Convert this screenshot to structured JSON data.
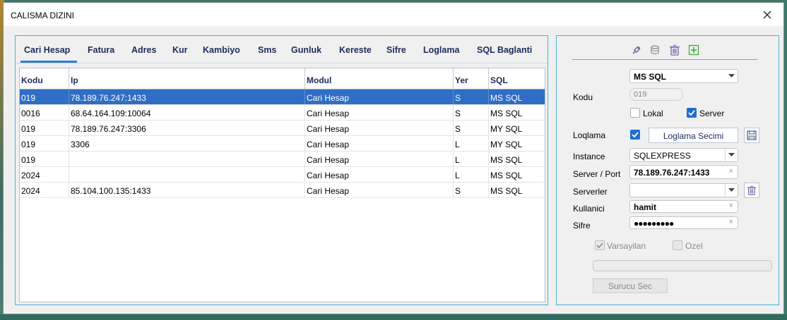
{
  "window": {
    "title": "CALISMA DIZINI"
  },
  "tabs": [
    {
      "label": "Cari Hesap",
      "active": true
    },
    {
      "label": "Fatura"
    },
    {
      "label": "Adres"
    },
    {
      "label": "Kur"
    },
    {
      "label": "Kambiyo"
    },
    {
      "label": "Sms"
    },
    {
      "label": "Gunluk"
    },
    {
      "label": "Kereste"
    },
    {
      "label": "Sifre"
    },
    {
      "label": "Loglama"
    },
    {
      "label": "SQL Baglanti"
    }
  ],
  "grid": {
    "columns": [
      "Kodu",
      "Ip",
      "Modul",
      "Yer",
      "SQL"
    ],
    "rows": [
      {
        "kodu": "019",
        "ip": "78.189.76.247:1433",
        "modul": "Cari Hesap",
        "yer": "S",
        "sql": "MS SQL",
        "selected": true
      },
      {
        "kodu": "0016",
        "ip": "68.64.164.109:10064",
        "modul": "Cari Hesap",
        "yer": "S",
        "sql": "MS SQL"
      },
      {
        "kodu": "019",
        "ip": "78.189.76.247:3306",
        "modul": "Cari Hesap",
        "yer": "S",
        "sql": "MY SQL"
      },
      {
        "kodu": "019",
        "ip": "3306",
        "modul": "Cari Hesap",
        "yer": "L",
        "sql": "MY SQL"
      },
      {
        "kodu": "019",
        "ip": "",
        "modul": "Cari Hesap",
        "yer": "L",
        "sql": "MS SQL"
      },
      {
        "kodu": "2024",
        "ip": "",
        "modul": "Cari Hesap",
        "yer": "L",
        "sql": "MS SQL"
      },
      {
        "kodu": "2024",
        "ip": "85.104.100.135:1433",
        "modul": "Cari Hesap",
        "yer": "S",
        "sql": "MS SQL"
      }
    ]
  },
  "form": {
    "sql_type": "MS SQL",
    "kodu_label": "Kodu",
    "kodu_value": "019",
    "lokal_label": "Lokal",
    "lokal_checked": false,
    "server_label": "Server",
    "server_checked": true,
    "loglama_label": "Loqlama",
    "loglama_checked": true,
    "loglama_button": "Loglama Secimi",
    "instance_label": "Instance",
    "instance_value": "SQLEXPRESS",
    "server_port_label": "Server / Port",
    "server_port_value": "78.189.76.247:1433",
    "serverler_label": "Serverler",
    "serverler_value": "",
    "kullanici_label": "Kullanici",
    "kullanici_value": "hamit",
    "sifre_label": "Sifre",
    "sifre_value": "●●●●●●●●●",
    "varsayilan_label": "Varsayilan",
    "varsayilan_checked": true,
    "ozel_label": "Ozel",
    "ozel_checked": false,
    "surucu_button": "Surucu Sec",
    "clear_glyph": "×"
  },
  "toolbar_icons": [
    "plug-icon",
    "database-icon",
    "trash-icon",
    "add-icon"
  ],
  "colors": {
    "accent": "#2f6ec4",
    "panel_border": "#4fb3d2",
    "label_text": "#1c2b5c",
    "add_green": "#3aa33a",
    "trash_purple": "#7a5fa8"
  }
}
